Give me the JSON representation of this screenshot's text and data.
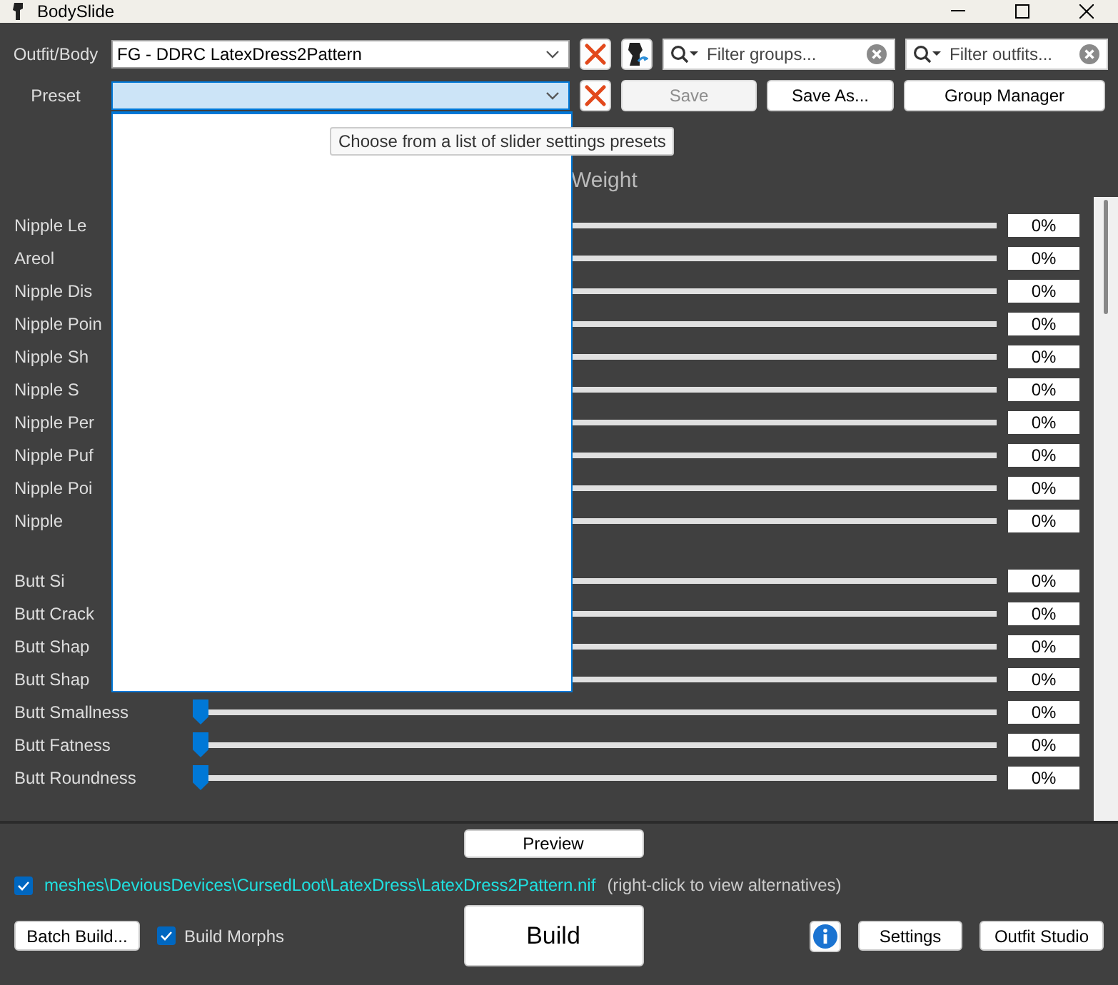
{
  "window": {
    "title": "BodySlide"
  },
  "outfit": {
    "label": "Outfit/Body",
    "value": "FG - DDRC LatexDress2Pattern"
  },
  "group_filter": {
    "placeholder": "Filter groups..."
  },
  "outfit_filter": {
    "placeholder": "Filter outfits..."
  },
  "preset": {
    "label": "Preset",
    "expanded": true
  },
  "preset_buttons": [
    {
      "label": "Save",
      "disabled": true
    },
    {
      "label": "Save As...",
      "disabled": false
    },
    {
      "label": "Group Manager",
      "disabled": false
    }
  ],
  "tooltip": "Choose from a list of slider settings presets",
  "column_heading": "Weight",
  "slider_groups": [
    {
      "sliders": [
        {
          "name": "Nipple Le",
          "reading": "0%"
        },
        {
          "name": "Areol",
          "reading": "0%"
        },
        {
          "name": "Nipple Dis",
          "reading": "0%"
        },
        {
          "name": "Nipple Poin",
          "reading": "0%"
        },
        {
          "name": "Nipple Sh",
          "reading": "0%"
        },
        {
          "name": "Nipple S",
          "reading": "0%"
        },
        {
          "name": "Nipple Per",
          "reading": "0%"
        },
        {
          "name": "Nipple Puf",
          "reading": "0%"
        },
        {
          "name": "Nipple Poi",
          "reading": "0%"
        },
        {
          "name": "Nipple",
          "reading": "0%"
        }
      ]
    },
    {
      "sliders": [
        {
          "name": "Butt Si",
          "reading": "0%"
        },
        {
          "name": "Butt Crack",
          "reading": "0%"
        },
        {
          "name": "Butt Shap",
          "reading": "0%"
        },
        {
          "name": "Butt Shap",
          "reading": "0%"
        },
        {
          "name": "Butt Smallness",
          "reading": "0%",
          "level": 0
        },
        {
          "name": "Butt Fatness",
          "reading": "0%",
          "level": 0
        },
        {
          "name": "Butt Roundness",
          "reading": "0%",
          "level": 0
        }
      ]
    }
  ],
  "preview_button": "Preview",
  "mesh": {
    "checked": true,
    "path": "meshes\\DeviousDevices\\CursedLoot\\LatexDress\\LatexDress2Pattern.nif",
    "hint": "(right-click to view alternatives)"
  },
  "batch_build_button": "Batch Build...",
  "build_morphs": {
    "label": "Build Morphs",
    "checked": true
  },
  "build_button": "Build",
  "settings_button": "Settings",
  "outfit_studio_button": "Outfit Studio"
}
